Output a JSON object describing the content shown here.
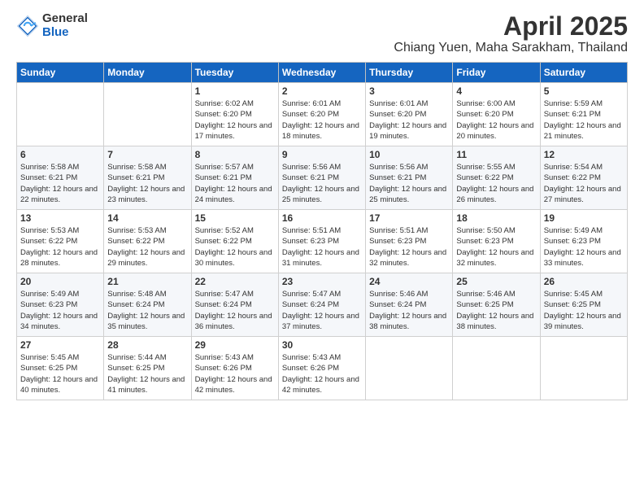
{
  "logo": {
    "general": "General",
    "blue": "Blue"
  },
  "title": {
    "month": "April 2025",
    "location": "Chiang Yuen, Maha Sarakham, Thailand"
  },
  "headers": [
    "Sunday",
    "Monday",
    "Tuesday",
    "Wednesday",
    "Thursday",
    "Friday",
    "Saturday"
  ],
  "weeks": [
    [
      {
        "day": "",
        "sunrise": "",
        "sunset": "",
        "daylight": ""
      },
      {
        "day": "",
        "sunrise": "",
        "sunset": "",
        "daylight": ""
      },
      {
        "day": "1",
        "sunrise": "Sunrise: 6:02 AM",
        "sunset": "Sunset: 6:20 PM",
        "daylight": "Daylight: 12 hours and 17 minutes."
      },
      {
        "day": "2",
        "sunrise": "Sunrise: 6:01 AM",
        "sunset": "Sunset: 6:20 PM",
        "daylight": "Daylight: 12 hours and 18 minutes."
      },
      {
        "day": "3",
        "sunrise": "Sunrise: 6:01 AM",
        "sunset": "Sunset: 6:20 PM",
        "daylight": "Daylight: 12 hours and 19 minutes."
      },
      {
        "day": "4",
        "sunrise": "Sunrise: 6:00 AM",
        "sunset": "Sunset: 6:20 PM",
        "daylight": "Daylight: 12 hours and 20 minutes."
      },
      {
        "day": "5",
        "sunrise": "Sunrise: 5:59 AM",
        "sunset": "Sunset: 6:21 PM",
        "daylight": "Daylight: 12 hours and 21 minutes."
      }
    ],
    [
      {
        "day": "6",
        "sunrise": "Sunrise: 5:58 AM",
        "sunset": "Sunset: 6:21 PM",
        "daylight": "Daylight: 12 hours and 22 minutes."
      },
      {
        "day": "7",
        "sunrise": "Sunrise: 5:58 AM",
        "sunset": "Sunset: 6:21 PM",
        "daylight": "Daylight: 12 hours and 23 minutes."
      },
      {
        "day": "8",
        "sunrise": "Sunrise: 5:57 AM",
        "sunset": "Sunset: 6:21 PM",
        "daylight": "Daylight: 12 hours and 24 minutes."
      },
      {
        "day": "9",
        "sunrise": "Sunrise: 5:56 AM",
        "sunset": "Sunset: 6:21 PM",
        "daylight": "Daylight: 12 hours and 25 minutes."
      },
      {
        "day": "10",
        "sunrise": "Sunrise: 5:56 AM",
        "sunset": "Sunset: 6:21 PM",
        "daylight": "Daylight: 12 hours and 25 minutes."
      },
      {
        "day": "11",
        "sunrise": "Sunrise: 5:55 AM",
        "sunset": "Sunset: 6:22 PM",
        "daylight": "Daylight: 12 hours and 26 minutes."
      },
      {
        "day": "12",
        "sunrise": "Sunrise: 5:54 AM",
        "sunset": "Sunset: 6:22 PM",
        "daylight": "Daylight: 12 hours and 27 minutes."
      }
    ],
    [
      {
        "day": "13",
        "sunrise": "Sunrise: 5:53 AM",
        "sunset": "Sunset: 6:22 PM",
        "daylight": "Daylight: 12 hours and 28 minutes."
      },
      {
        "day": "14",
        "sunrise": "Sunrise: 5:53 AM",
        "sunset": "Sunset: 6:22 PM",
        "daylight": "Daylight: 12 hours and 29 minutes."
      },
      {
        "day": "15",
        "sunrise": "Sunrise: 5:52 AM",
        "sunset": "Sunset: 6:22 PM",
        "daylight": "Daylight: 12 hours and 30 minutes."
      },
      {
        "day": "16",
        "sunrise": "Sunrise: 5:51 AM",
        "sunset": "Sunset: 6:23 PM",
        "daylight": "Daylight: 12 hours and 31 minutes."
      },
      {
        "day": "17",
        "sunrise": "Sunrise: 5:51 AM",
        "sunset": "Sunset: 6:23 PM",
        "daylight": "Daylight: 12 hours and 32 minutes."
      },
      {
        "day": "18",
        "sunrise": "Sunrise: 5:50 AM",
        "sunset": "Sunset: 6:23 PM",
        "daylight": "Daylight: 12 hours and 32 minutes."
      },
      {
        "day": "19",
        "sunrise": "Sunrise: 5:49 AM",
        "sunset": "Sunset: 6:23 PM",
        "daylight": "Daylight: 12 hours and 33 minutes."
      }
    ],
    [
      {
        "day": "20",
        "sunrise": "Sunrise: 5:49 AM",
        "sunset": "Sunset: 6:23 PM",
        "daylight": "Daylight: 12 hours and 34 minutes."
      },
      {
        "day": "21",
        "sunrise": "Sunrise: 5:48 AM",
        "sunset": "Sunset: 6:24 PM",
        "daylight": "Daylight: 12 hours and 35 minutes."
      },
      {
        "day": "22",
        "sunrise": "Sunrise: 5:47 AM",
        "sunset": "Sunset: 6:24 PM",
        "daylight": "Daylight: 12 hours and 36 minutes."
      },
      {
        "day": "23",
        "sunrise": "Sunrise: 5:47 AM",
        "sunset": "Sunset: 6:24 PM",
        "daylight": "Daylight: 12 hours and 37 minutes."
      },
      {
        "day": "24",
        "sunrise": "Sunrise: 5:46 AM",
        "sunset": "Sunset: 6:24 PM",
        "daylight": "Daylight: 12 hours and 38 minutes."
      },
      {
        "day": "25",
        "sunrise": "Sunrise: 5:46 AM",
        "sunset": "Sunset: 6:25 PM",
        "daylight": "Daylight: 12 hours and 38 minutes."
      },
      {
        "day": "26",
        "sunrise": "Sunrise: 5:45 AM",
        "sunset": "Sunset: 6:25 PM",
        "daylight": "Daylight: 12 hours and 39 minutes."
      }
    ],
    [
      {
        "day": "27",
        "sunrise": "Sunrise: 5:45 AM",
        "sunset": "Sunset: 6:25 PM",
        "daylight": "Daylight: 12 hours and 40 minutes."
      },
      {
        "day": "28",
        "sunrise": "Sunrise: 5:44 AM",
        "sunset": "Sunset: 6:25 PM",
        "daylight": "Daylight: 12 hours and 41 minutes."
      },
      {
        "day": "29",
        "sunrise": "Sunrise: 5:43 AM",
        "sunset": "Sunset: 6:26 PM",
        "daylight": "Daylight: 12 hours and 42 minutes."
      },
      {
        "day": "30",
        "sunrise": "Sunrise: 5:43 AM",
        "sunset": "Sunset: 6:26 PM",
        "daylight": "Daylight: 12 hours and 42 minutes."
      },
      {
        "day": "",
        "sunrise": "",
        "sunset": "",
        "daylight": ""
      },
      {
        "day": "",
        "sunrise": "",
        "sunset": "",
        "daylight": ""
      },
      {
        "day": "",
        "sunrise": "",
        "sunset": "",
        "daylight": ""
      }
    ]
  ]
}
